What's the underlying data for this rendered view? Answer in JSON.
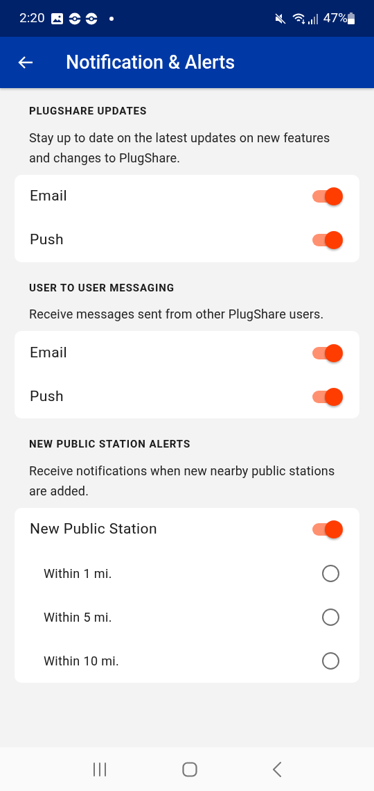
{
  "status_bar": {
    "time": "2:20",
    "battery": "47%"
  },
  "app_bar": {
    "title": "Notification & Alerts"
  },
  "sections": [
    {
      "heading": "PLUGSHARE UPDATES",
      "description": "Stay up to date on the latest updates on new features and changes to PlugShare.",
      "options": [
        {
          "kind": "toggle",
          "label": "Email",
          "on": true
        },
        {
          "kind": "toggle",
          "label": "Push",
          "on": true
        }
      ]
    },
    {
      "heading": "USER TO USER MESSAGING",
      "description": "Receive messages sent from other PlugShare users.",
      "options": [
        {
          "kind": "toggle",
          "label": "Email",
          "on": true
        },
        {
          "kind": "toggle",
          "label": "Push",
          "on": true
        }
      ]
    },
    {
      "heading": "NEW PUBLIC STATION ALERTS",
      "description": "Receive notifications when new nearby public stations are added.",
      "options": [
        {
          "kind": "toggle",
          "label": "New Public Station",
          "on": true
        },
        {
          "kind": "radio",
          "label": "Within 1 mi.",
          "selected": false
        },
        {
          "kind": "radio",
          "label": "Within 5 mi.",
          "selected": false
        },
        {
          "kind": "radio",
          "label": "Within 10 mi.",
          "selected": false
        }
      ]
    }
  ]
}
